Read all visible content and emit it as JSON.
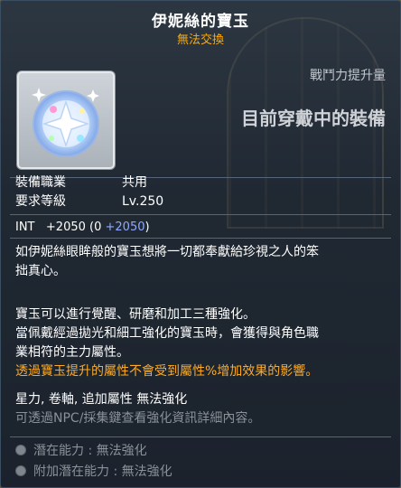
{
  "item": {
    "name": "伊妮絲的寶玉",
    "trade_status": "無法交換",
    "icon": "inner-ability-gem-icon"
  },
  "comparison": {
    "power_label": "戰鬥力提升量",
    "equipped_label": "目前穿戴中的裝備"
  },
  "requirements": {
    "job_label": "裝備職業",
    "job_value": "共用",
    "level_label": "要求等級",
    "level_value": "Lv.250"
  },
  "stat": {
    "name": "INT",
    "total": "+2050",
    "open": "(0",
    "bonus": "+2050",
    "close": ")"
  },
  "description": {
    "flavor_line1": "如伊妮絲眼眸般的寶玉想將一切都奉獻給珍視之人的笨",
    "flavor_line2": "拙真心。",
    "info_line1": "寶玉可以進行覺醒、研磨和加工三種強化。",
    "info_line2": "當佩戴經過拋光和細工強化的寶玉時，會獲得與角色職",
    "info_line3": "業相符的主力屬性。",
    "warning": "透過寶玉提升的屬性不會受到屬性%增加效果的影響。",
    "no_enhance": "星力, 卷軸, 追加屬性 無法強化",
    "hint": "可透過NPC/採集鍵查看強化資訊詳細內容。"
  },
  "potentials": {
    "potential": "潛在能力 : 無法強化",
    "additional": "附加潛在能力 : 無法強化"
  },
  "colors": {
    "trade_status": "#ffaa00",
    "bonus_stat": "#8fa8ff",
    "warning": "#ffaa22",
    "disabled": "#8a9198"
  }
}
